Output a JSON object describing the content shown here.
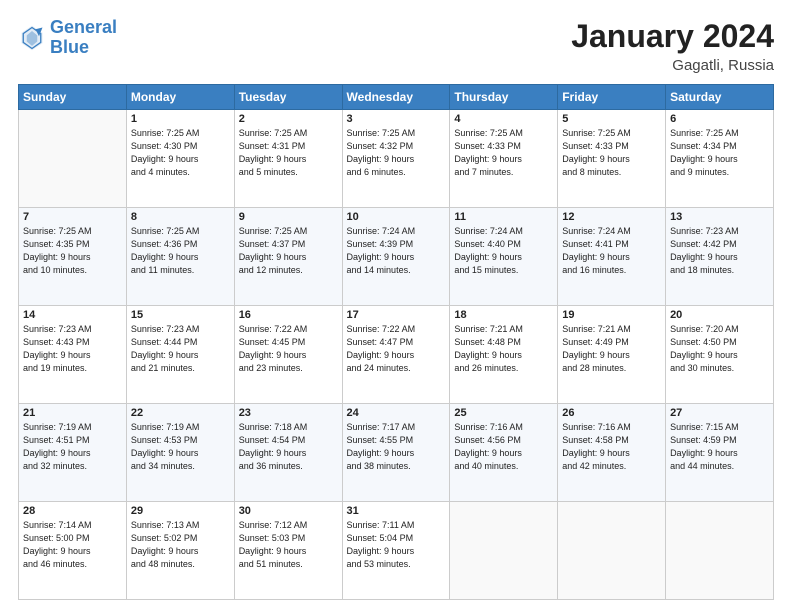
{
  "header": {
    "logo_line1": "General",
    "logo_line2": "Blue",
    "title": "January 2024",
    "subtitle": "Gagatli, Russia"
  },
  "columns": [
    "Sunday",
    "Monday",
    "Tuesday",
    "Wednesday",
    "Thursday",
    "Friday",
    "Saturday"
  ],
  "weeks": [
    {
      "days": [
        {
          "num": "",
          "info": ""
        },
        {
          "num": "1",
          "info": "Sunrise: 7:25 AM\nSunset: 4:30 PM\nDaylight: 9 hours\nand 4 minutes."
        },
        {
          "num": "2",
          "info": "Sunrise: 7:25 AM\nSunset: 4:31 PM\nDaylight: 9 hours\nand 5 minutes."
        },
        {
          "num": "3",
          "info": "Sunrise: 7:25 AM\nSunset: 4:32 PM\nDaylight: 9 hours\nand 6 minutes."
        },
        {
          "num": "4",
          "info": "Sunrise: 7:25 AM\nSunset: 4:33 PM\nDaylight: 9 hours\nand 7 minutes."
        },
        {
          "num": "5",
          "info": "Sunrise: 7:25 AM\nSunset: 4:33 PM\nDaylight: 9 hours\nand 8 minutes."
        },
        {
          "num": "6",
          "info": "Sunrise: 7:25 AM\nSunset: 4:34 PM\nDaylight: 9 hours\nand 9 minutes."
        }
      ]
    },
    {
      "days": [
        {
          "num": "7",
          "info": "Sunrise: 7:25 AM\nSunset: 4:35 PM\nDaylight: 9 hours\nand 10 minutes."
        },
        {
          "num": "8",
          "info": "Sunrise: 7:25 AM\nSunset: 4:36 PM\nDaylight: 9 hours\nand 11 minutes."
        },
        {
          "num": "9",
          "info": "Sunrise: 7:25 AM\nSunset: 4:37 PM\nDaylight: 9 hours\nand 12 minutes."
        },
        {
          "num": "10",
          "info": "Sunrise: 7:24 AM\nSunset: 4:39 PM\nDaylight: 9 hours\nand 14 minutes."
        },
        {
          "num": "11",
          "info": "Sunrise: 7:24 AM\nSunset: 4:40 PM\nDaylight: 9 hours\nand 15 minutes."
        },
        {
          "num": "12",
          "info": "Sunrise: 7:24 AM\nSunset: 4:41 PM\nDaylight: 9 hours\nand 16 minutes."
        },
        {
          "num": "13",
          "info": "Sunrise: 7:23 AM\nSunset: 4:42 PM\nDaylight: 9 hours\nand 18 minutes."
        }
      ]
    },
    {
      "days": [
        {
          "num": "14",
          "info": "Sunrise: 7:23 AM\nSunset: 4:43 PM\nDaylight: 9 hours\nand 19 minutes."
        },
        {
          "num": "15",
          "info": "Sunrise: 7:23 AM\nSunset: 4:44 PM\nDaylight: 9 hours\nand 21 minutes."
        },
        {
          "num": "16",
          "info": "Sunrise: 7:22 AM\nSunset: 4:45 PM\nDaylight: 9 hours\nand 23 minutes."
        },
        {
          "num": "17",
          "info": "Sunrise: 7:22 AM\nSunset: 4:47 PM\nDaylight: 9 hours\nand 24 minutes."
        },
        {
          "num": "18",
          "info": "Sunrise: 7:21 AM\nSunset: 4:48 PM\nDaylight: 9 hours\nand 26 minutes."
        },
        {
          "num": "19",
          "info": "Sunrise: 7:21 AM\nSunset: 4:49 PM\nDaylight: 9 hours\nand 28 minutes."
        },
        {
          "num": "20",
          "info": "Sunrise: 7:20 AM\nSunset: 4:50 PM\nDaylight: 9 hours\nand 30 minutes."
        }
      ]
    },
    {
      "days": [
        {
          "num": "21",
          "info": "Sunrise: 7:19 AM\nSunset: 4:51 PM\nDaylight: 9 hours\nand 32 minutes."
        },
        {
          "num": "22",
          "info": "Sunrise: 7:19 AM\nSunset: 4:53 PM\nDaylight: 9 hours\nand 34 minutes."
        },
        {
          "num": "23",
          "info": "Sunrise: 7:18 AM\nSunset: 4:54 PM\nDaylight: 9 hours\nand 36 minutes."
        },
        {
          "num": "24",
          "info": "Sunrise: 7:17 AM\nSunset: 4:55 PM\nDaylight: 9 hours\nand 38 minutes."
        },
        {
          "num": "25",
          "info": "Sunrise: 7:16 AM\nSunset: 4:56 PM\nDaylight: 9 hours\nand 40 minutes."
        },
        {
          "num": "26",
          "info": "Sunrise: 7:16 AM\nSunset: 4:58 PM\nDaylight: 9 hours\nand 42 minutes."
        },
        {
          "num": "27",
          "info": "Sunrise: 7:15 AM\nSunset: 4:59 PM\nDaylight: 9 hours\nand 44 minutes."
        }
      ]
    },
    {
      "days": [
        {
          "num": "28",
          "info": "Sunrise: 7:14 AM\nSunset: 5:00 PM\nDaylight: 9 hours\nand 46 minutes."
        },
        {
          "num": "29",
          "info": "Sunrise: 7:13 AM\nSunset: 5:02 PM\nDaylight: 9 hours\nand 48 minutes."
        },
        {
          "num": "30",
          "info": "Sunrise: 7:12 AM\nSunset: 5:03 PM\nDaylight: 9 hours\nand 51 minutes."
        },
        {
          "num": "31",
          "info": "Sunrise: 7:11 AM\nSunset: 5:04 PM\nDaylight: 9 hours\nand 53 minutes."
        },
        {
          "num": "",
          "info": ""
        },
        {
          "num": "",
          "info": ""
        },
        {
          "num": "",
          "info": ""
        }
      ]
    }
  ]
}
